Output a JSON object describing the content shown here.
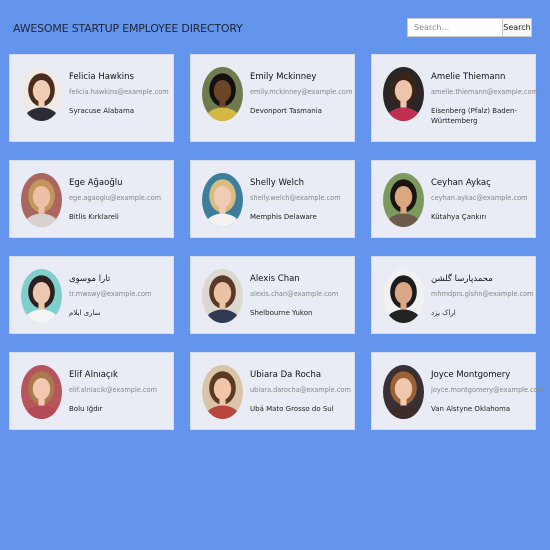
{
  "header": {
    "title": "AWESOME STARTUP EMPLOYEE DIRECTORY",
    "search_placeholder": "Search...",
    "search_button": "Search"
  },
  "employees": [
    {
      "name": "Felicia Hawkins",
      "email": "felicia.hawkins@example.com",
      "location": "Syracuse Alabama",
      "photo": {
        "bg": "#efeae6",
        "skin": "#f1cdb6",
        "hair": "#4a2d1d",
        "top": "#2c2c36"
      }
    },
    {
      "name": "Emily Mckinney",
      "email": "emily.mckinney@example.com",
      "location": "Devonport Tasmania",
      "photo": {
        "bg": "#6f7a4e",
        "skin": "#6b4528",
        "hair": "#151010",
        "top": "#d6b840"
      }
    },
    {
      "name": "Amelie Thiemann",
      "email": "amelie.thiemann@example.com",
      "location": "Eisenberg (Pfalz) Baden-Württemberg",
      "photo": {
        "bg": "#2a2628",
        "skin": "#eec4ad",
        "hair": "#3a2418",
        "top": "#bf3050"
      }
    },
    {
      "name": "Ege Ağaoğlu",
      "email": "ege.agaoglu@example.com",
      "location": "Bitlis Kırklareli",
      "photo": {
        "bg": "#a8665f",
        "skin": "#eec0a6",
        "hair": "#c4965e",
        "top": "#d9d2cc"
      }
    },
    {
      "name": "Shelly Welch",
      "email": "shelly.welch@example.com",
      "location": "Memphis Delaware",
      "photo": {
        "bg": "#3d7e9c",
        "skin": "#f0ccb6",
        "hair": "#d9bc80",
        "top": "#f4f2f0"
      }
    },
    {
      "name": "Ceyhan Aykaç",
      "email": "ceyhan.aykac@example.com",
      "location": "Kütahya Çankırı",
      "photo": {
        "bg": "#7b9a5e",
        "skin": "#d9a882",
        "hair": "#1c1410",
        "top": "#6e5a4a"
      }
    },
    {
      "name": "تارا موسوی",
      "email": "tr.mwswy@example.com",
      "location": "ساری ایلام",
      "photo": {
        "bg": "#7fd0cc",
        "skin": "#ecc8b0",
        "hair": "#2a2022",
        "top": "#f4f4f4"
      }
    },
    {
      "name": "Alexis Chan",
      "email": "alexis.chan@example.com",
      "location": "Shelbourne Yukon",
      "photo": {
        "bg": "#dcd8d0",
        "skin": "#eac2a4",
        "hair": "#5a3a26",
        "top": "#2e3b52"
      }
    },
    {
      "name": "محمدپارسا گلشن",
      "email": "mhmdprs.glshn@example.com",
      "location": "اراک یزد",
      "photo": {
        "bg": "#f1f1f1",
        "skin": "#d9a886",
        "hair": "#1c1c1c",
        "top": "#232323"
      }
    },
    {
      "name": "Elif Alnıaçık",
      "email": "elif.alniacik@example.com",
      "location": "Bolu Iğdır",
      "photo": {
        "bg": "#b8545c",
        "skin": "#f2c8b0",
        "hair": "#a87a4c",
        "top": "#b34a56"
      }
    },
    {
      "name": "Ubiara Da Rocha",
      "email": "ubiara.darocha@example.com",
      "location": "Ubá Mato Grosso do Sul",
      "photo": {
        "bg": "#d8c4a8",
        "skin": "#efc6aa",
        "hair": "#5a3a22",
        "top": "#b8463e"
      }
    },
    {
      "name": "Joyce Montgomery",
      "email": "joyce.montgomery@example.com",
      "location": "Van Alstyne Oklahoma",
      "photo": {
        "bg": "#3a3034",
        "skin": "#f0c8ae",
        "hair": "#9a6236",
        "top": "#3e2a26"
      }
    }
  ]
}
